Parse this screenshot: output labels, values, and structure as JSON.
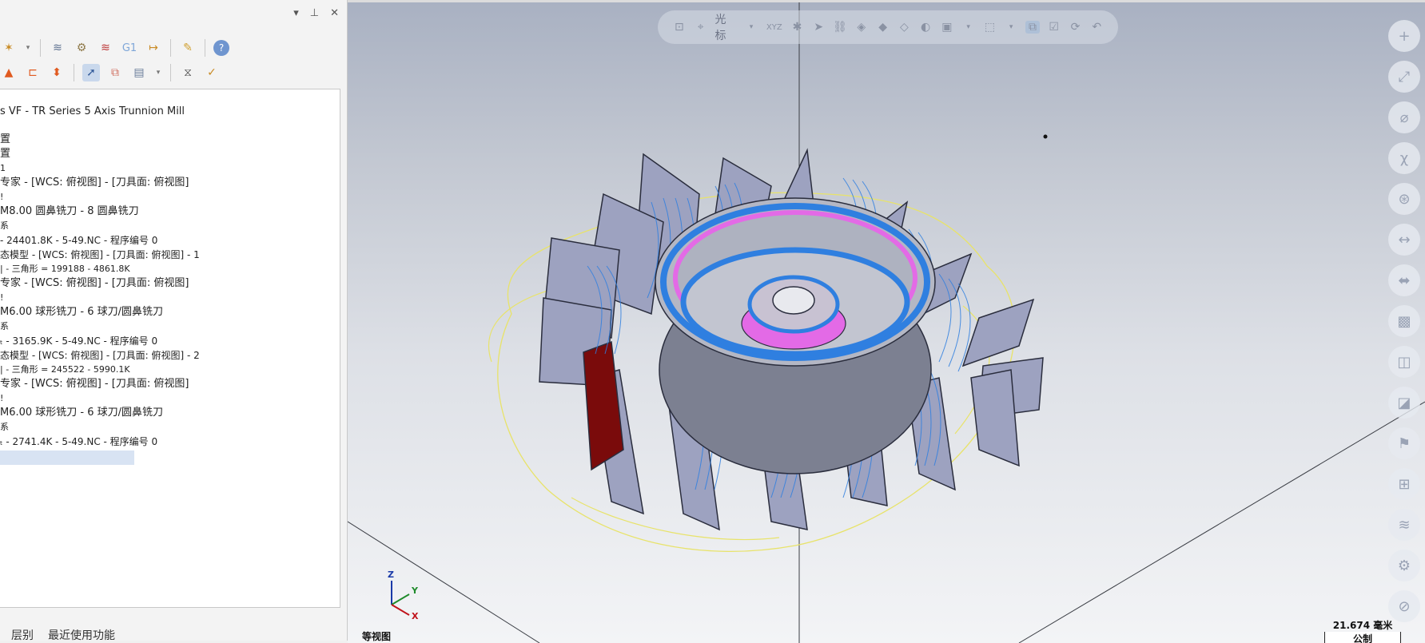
{
  "panel": {
    "header_icons": [
      "pin-dropdown-icon",
      "pin-icon",
      "close-icon"
    ],
    "close_label": "✕",
    "toolbar_row1": [
      "toolpath-op-icon",
      "dropdown-icon",
      "regen-icon",
      "multi-regen-icon",
      "dirty-regen-icon",
      "g1-icon",
      "post-icon",
      "highlight-icon",
      "help-icon"
    ],
    "g1_label": "G1",
    "toolbar_row2": [
      "up-arrow-icon",
      "move-icon",
      "updown-icon",
      "select-icon",
      "toolpath-display-icon",
      "filter-icon",
      "backplot-icon",
      "verify-icon"
    ],
    "tree": [
      "s VF - TR Series 5 Axis Trunnion Mill",
      "置",
      "置",
      "1",
      "专家 - [WCS: 俯视图] - [刀具面: 俯视图]",
      "!",
      "M8.00 圆鼻铣刀 - 8 圆鼻铣刀",
      "系",
      "- 24401.8K - 5-49.NC - 程序编号 0",
      "态模型 - [WCS: 俯视图] - [刀具面: 俯视图] - 1",
      "| - 三角形 =  199188 - 4861.8K",
      "专家 - [WCS: 俯视图] - [刀具面: 俯视图]",
      "!",
      "M6.00 球形铣刀 - 6 球刀/圆鼻铣刀",
      "系",
      "ₜ - 3165.9K - 5-49.NC - 程序编号 0",
      "态模型 - [WCS: 俯视图] - [刀具面: 俯视图] - 2",
      "| - 三角形 =  245522 - 5990.1K",
      "专家 - [WCS: 俯视图] - [刀具面: 俯视图]",
      "!",
      "M6.00 球形铣刀 - 6 球刀/圆鼻铣刀",
      "系",
      "ₜ - 2741.4K - 5-49.NC - 程序编号 0"
    ],
    "bottom_tabs": [
      "层别",
      "最近使用功能"
    ]
  },
  "viewport": {
    "toolbar_cursor_label": "光标",
    "toolbar_xyz_label": "XYZ",
    "view_name": "等视图",
    "scale_value": "21.674 毫米",
    "scale_unit": "公制",
    "triad": {
      "z": "Z",
      "y": "Y",
      "x": "X"
    },
    "right_bar_icons": [
      "zoom-in-icon",
      "axis-icon",
      "diameter-icon",
      "curve-icon",
      "rotate-icon",
      "distance-icon",
      "measure-icon",
      "cube-icon",
      "views-icon",
      "color-icon",
      "flag-icon",
      "grid-icon",
      "layers-icon",
      "gear-icon",
      "cancel-icon"
    ],
    "colors": {
      "blade": "#9da2c0",
      "toolpath": "#2f7fe0",
      "hub": "#7c8091",
      "ring_magenta": "#e36ae6",
      "boundary": "#e8e36a",
      "selected_blade": "#7a0b0b"
    }
  }
}
